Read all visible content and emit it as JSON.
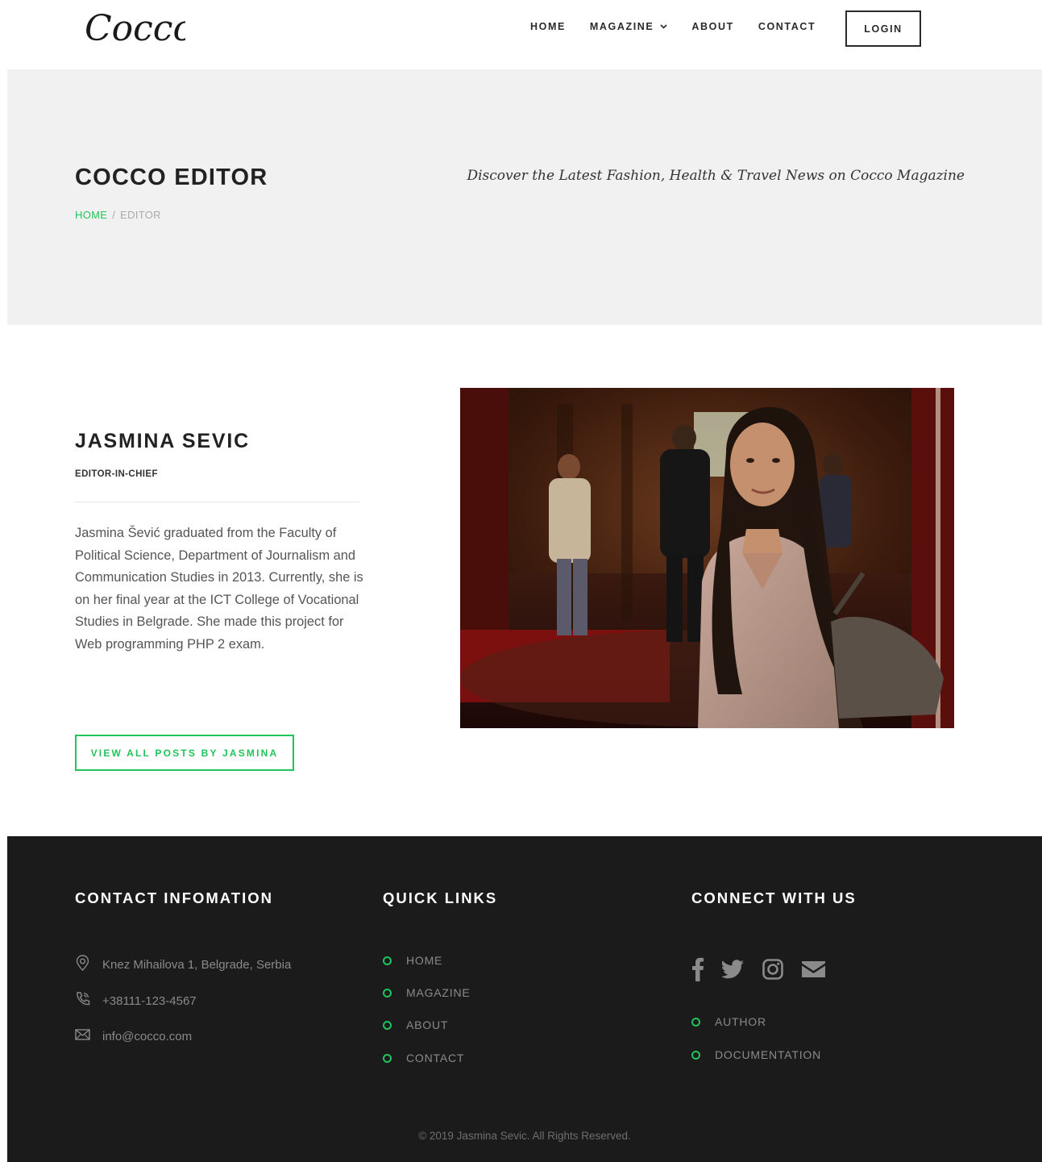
{
  "brand": {
    "logo_text": "Cocco"
  },
  "nav": {
    "items": [
      {
        "label": "HOME"
      },
      {
        "label": "MAGAZINE",
        "has_dropdown": true
      },
      {
        "label": "ABOUT"
      },
      {
        "label": "CONTACT"
      }
    ],
    "login_label": "LOGIN"
  },
  "hero": {
    "title": "COCCO EDITOR",
    "tagline": "Discover the Latest Fashion, Health & Travel News on Cocco Magazine",
    "breadcrumb": {
      "home": "HOME",
      "separator": "/",
      "current": "EDITOR"
    }
  },
  "profile": {
    "name": "JASMINA SEVIC",
    "role": "EDITOR-IN-CHIEF",
    "bio": "Jasmina Šević graduated from the Faculty of Political Science, Department of Journalism and Communication Studies in 2013. Currently, she is on her final year at the ICT College of Vocational Studies in Belgrade. She made this project for Web programming PHP 2 exam.",
    "button_label": "VIEW ALL POSTS BY JASMINA"
  },
  "footer": {
    "contact": {
      "heading": "CONTACT INFOMATION",
      "address": "Knez Mihailova 1, Belgrade, Serbia",
      "phone": "+38111-123-4567",
      "email": "info@cocco.com"
    },
    "quick_links": {
      "heading": "QUICK LINKS",
      "items": [
        "HOME",
        "MAGAZINE",
        "ABOUT",
        "CONTACT"
      ]
    },
    "connect": {
      "heading": "CONNECT WITH US",
      "social_icons": [
        "facebook-icon",
        "twitter-icon",
        "instagram-icon",
        "email-icon"
      ],
      "links": [
        "AUTHOR",
        "DOCUMENTATION"
      ]
    },
    "copyright": "© 2019 Jasmina Sevic. All Rights Reserved."
  },
  "colors": {
    "accent": "#21c45a",
    "footer_bg": "#1b1b1b",
    "hero_bg": "#f1f1f1",
    "text_dark": "#222222"
  }
}
